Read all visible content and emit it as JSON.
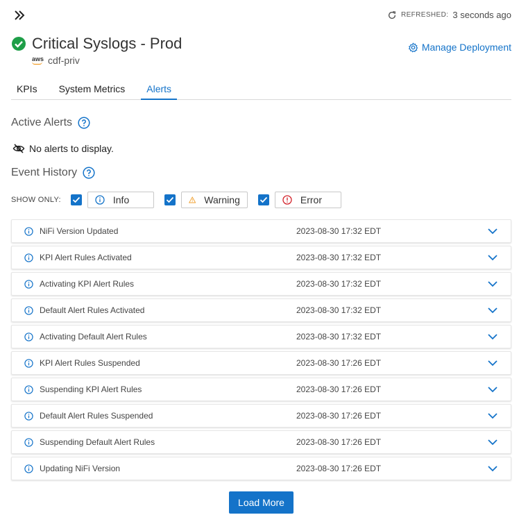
{
  "header": {
    "refreshed_label": "REFRESHED:",
    "refreshed_value": "3 seconds ago",
    "title": "Critical Syslogs - Prod",
    "cloud_provider": "aws",
    "environment": "cdf-priv",
    "manage_label": "Manage Deployment",
    "status_color": "#1e9e48",
    "accent_color": "#1473c9"
  },
  "tabs": [
    {
      "label": "KPIs",
      "active": false
    },
    {
      "label": "System Metrics",
      "active": false
    },
    {
      "label": "Alerts",
      "active": true
    }
  ],
  "active_alerts": {
    "heading": "Active Alerts",
    "empty_message": "No alerts to display."
  },
  "event_history": {
    "heading": "Event History",
    "show_only_label": "SHOW ONLY:",
    "filters": [
      {
        "label": "Info",
        "checked": true,
        "icon": "info-icon"
      },
      {
        "label": "Warning",
        "checked": true,
        "icon": "warning-icon"
      },
      {
        "label": "Error",
        "checked": true,
        "icon": "error-icon"
      }
    ],
    "events": [
      {
        "name": "NiFi Version Updated",
        "time": "2023-08-30 17:32 EDT"
      },
      {
        "name": "KPI Alert Rules Activated",
        "time": "2023-08-30 17:32 EDT"
      },
      {
        "name": "Activating KPI Alert Rules",
        "time": "2023-08-30 17:32 EDT"
      },
      {
        "name": "Default Alert Rules Activated",
        "time": "2023-08-30 17:32 EDT"
      },
      {
        "name": "Activating Default Alert Rules",
        "time": "2023-08-30 17:32 EDT"
      },
      {
        "name": "KPI Alert Rules Suspended",
        "time": "2023-08-30 17:26 EDT"
      },
      {
        "name": "Suspending KPI Alert Rules",
        "time": "2023-08-30 17:26 EDT"
      },
      {
        "name": "Default Alert Rules Suspended",
        "time": "2023-08-30 17:26 EDT"
      },
      {
        "name": "Suspending Default Alert Rules",
        "time": "2023-08-30 17:26 EDT"
      },
      {
        "name": "Updating NiFi Version",
        "time": "2023-08-30 17:26 EDT"
      }
    ],
    "load_more_label": "Load More"
  }
}
